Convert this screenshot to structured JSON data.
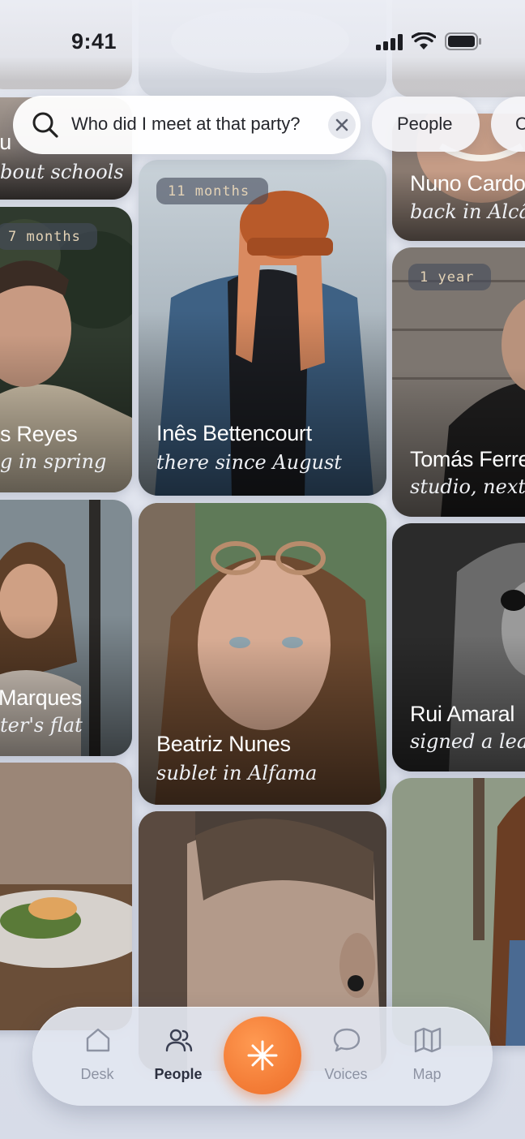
{
  "status_bar": {
    "time": "9:41"
  },
  "search": {
    "query": "Who did I meet at that party?"
  },
  "filter_chips": [
    {
      "label": "People"
    },
    {
      "label": "C"
    }
  ],
  "cards": {
    "left_top": {
      "subtitle": "bout schools",
      "name": "Nu"
    },
    "left_reyes": {
      "badge": "7 months",
      "name": "s Reyes",
      "subtitle": "g in spring"
    },
    "left_marques": {
      "name": "Marques",
      "subtitle": "ter's flat"
    },
    "center_ines": {
      "badge": "11 months",
      "name": "Inês Bettencourt",
      "subtitle": "there since August"
    },
    "center_beatriz": {
      "name": "Beatriz Nunes",
      "subtitle": "sublet in Alfama"
    },
    "right_nuno": {
      "name": "Nuno Cardos",
      "subtitle": "back in Alcâ"
    },
    "right_tomas": {
      "badge": "1 year",
      "name": "Tomás Ferre",
      "subtitle": "studio, next"
    },
    "right_rui": {
      "name": "Rui Amaral",
      "subtitle": "signed a leas"
    }
  },
  "tabbar": {
    "tabs": [
      {
        "label": "Desk",
        "icon": "home-icon",
        "active": false
      },
      {
        "label": "People",
        "icon": "people-icon",
        "active": true
      },
      {
        "label": "Voices",
        "icon": "speech-bubble-icon",
        "active": false
      },
      {
        "label": "Map",
        "icon": "map-icon",
        "active": false
      }
    ],
    "center_action": {
      "icon": "asterisk-icon"
    }
  },
  "colors": {
    "accent": "#F47E38",
    "badge_text": "#E4D3B6",
    "tab_active": "#2C3040",
    "tab_inactive": "#8D93A3"
  }
}
